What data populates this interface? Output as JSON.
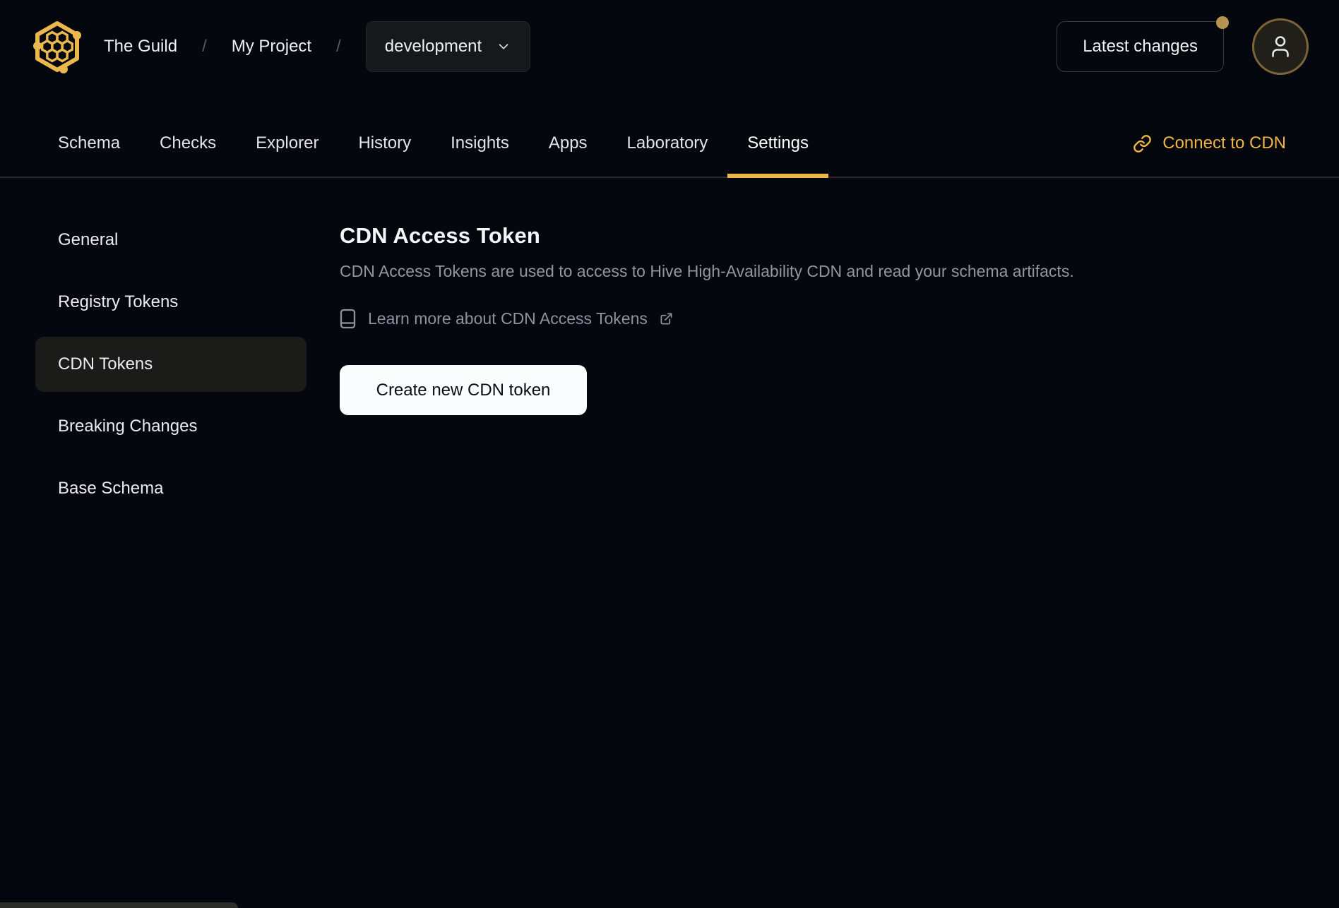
{
  "header": {
    "breadcrumb": {
      "organization": "The Guild",
      "separator": "/",
      "project": "My Project",
      "target_selected": "development"
    },
    "latest_changes_label": "Latest changes",
    "notification_dot": true
  },
  "tabs": {
    "items": [
      {
        "label": "Schema",
        "active": false
      },
      {
        "label": "Checks",
        "active": false
      },
      {
        "label": "Explorer",
        "active": false
      },
      {
        "label": "History",
        "active": false
      },
      {
        "label": "Insights",
        "active": false
      },
      {
        "label": "Apps",
        "active": false
      },
      {
        "label": "Laboratory",
        "active": false
      },
      {
        "label": "Settings",
        "active": true
      }
    ],
    "connect_cdn_label": "Connect to CDN"
  },
  "sidebar": {
    "items": [
      {
        "label": "General",
        "active": false
      },
      {
        "label": "Registry Tokens",
        "active": false
      },
      {
        "label": "CDN Tokens",
        "active": true
      },
      {
        "label": "Breaking Changes",
        "active": false
      },
      {
        "label": "Base Schema",
        "active": false
      }
    ]
  },
  "main": {
    "title": "CDN Access Token",
    "description": "CDN Access Tokens are used to access to Hive High-Availability CDN and read your schema artifacts.",
    "learn_more_label": "Learn more about CDN Access Tokens",
    "create_button_label": "Create new CDN token"
  },
  "icons": {
    "logo": "hive-honeycomb-logo",
    "target_dropdown": "chevron-down-icon",
    "avatar": "user-icon",
    "connect_cdn": "link-icon",
    "learn_more_leading": "book-icon",
    "learn_more_trailing": "external-link-icon"
  },
  "colors": {
    "background": "#05070e",
    "accent_gold": "#ecb64a",
    "link_gold": "#eeb543",
    "notification_dot": "#b5944d",
    "avatar_ring": "#7d6538",
    "panel": "#17181c",
    "sidebar_active_bg": "#1b1b1a",
    "muted_text": "#92969e",
    "primary_button_bg": "#fbfcfd",
    "primary_button_text": "#0b0d12",
    "toast_bg": "#2c2c29"
  }
}
